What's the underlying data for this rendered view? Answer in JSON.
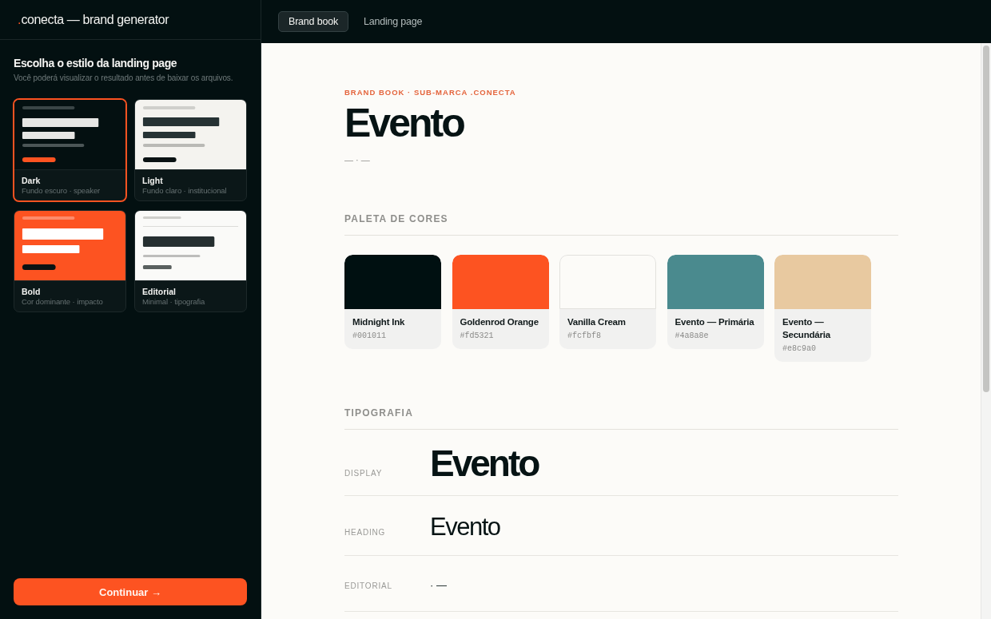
{
  "sidebar": {
    "logo": {
      "dot": ".",
      "name": "conecta — brand generator"
    },
    "heading": "Escolha o estilo da landing page",
    "subheading": "Você poderá visualizar o resultado antes de baixar os arquivos.",
    "styles": [
      {
        "kind": "dark",
        "name": "Dark",
        "description": "Fundo escuro · speaker",
        "selected": true
      },
      {
        "kind": "light",
        "name": "Light",
        "description": "Fundo claro · institucional",
        "selected": false
      },
      {
        "kind": "bold",
        "name": "Bold",
        "description": "Cor dominante · impacto",
        "selected": false
      },
      {
        "kind": "editorial",
        "name": "Editorial",
        "description": "Minimal · tipografia",
        "selected": false
      }
    ],
    "continue_button": "Continuar →"
  },
  "tabs": [
    {
      "label": "Brand book",
      "selected": true
    },
    {
      "label": "Landing page",
      "selected": false
    }
  ],
  "brand_book": {
    "eyebrow": "BRAND BOOK · SUB-MARCA .CONECTA",
    "title": "Evento",
    "tagline": "— · —",
    "palette": {
      "heading": "PALETA DE CORES",
      "colors": [
        {
          "name": "Midnight Ink",
          "hex": "#001011",
          "color": "#001011"
        },
        {
          "name": "Goldenrod Orange",
          "hex": "#fd5321",
          "color": "#fd5321"
        },
        {
          "name": "Vanilla Cream",
          "hex": "#fcfbf8",
          "color": "#fcfbf8"
        },
        {
          "name": "Evento — Primária",
          "hex": "#4a8a8e",
          "color": "#4a8a8e"
        },
        {
          "name": "Evento — Secundária",
          "hex": "#e8c9a0",
          "color": "#e8c9a0"
        }
      ]
    },
    "typography": {
      "heading": "TIPOGRAFIA",
      "rows": [
        {
          "kind": "display",
          "label": "DISPLAY",
          "sample": "Evento"
        },
        {
          "kind": "heading",
          "label": "HEADING",
          "sample": "Evento"
        },
        {
          "kind": "editorial",
          "label": "EDITORIAL",
          "sample": "· —"
        }
      ]
    }
  }
}
